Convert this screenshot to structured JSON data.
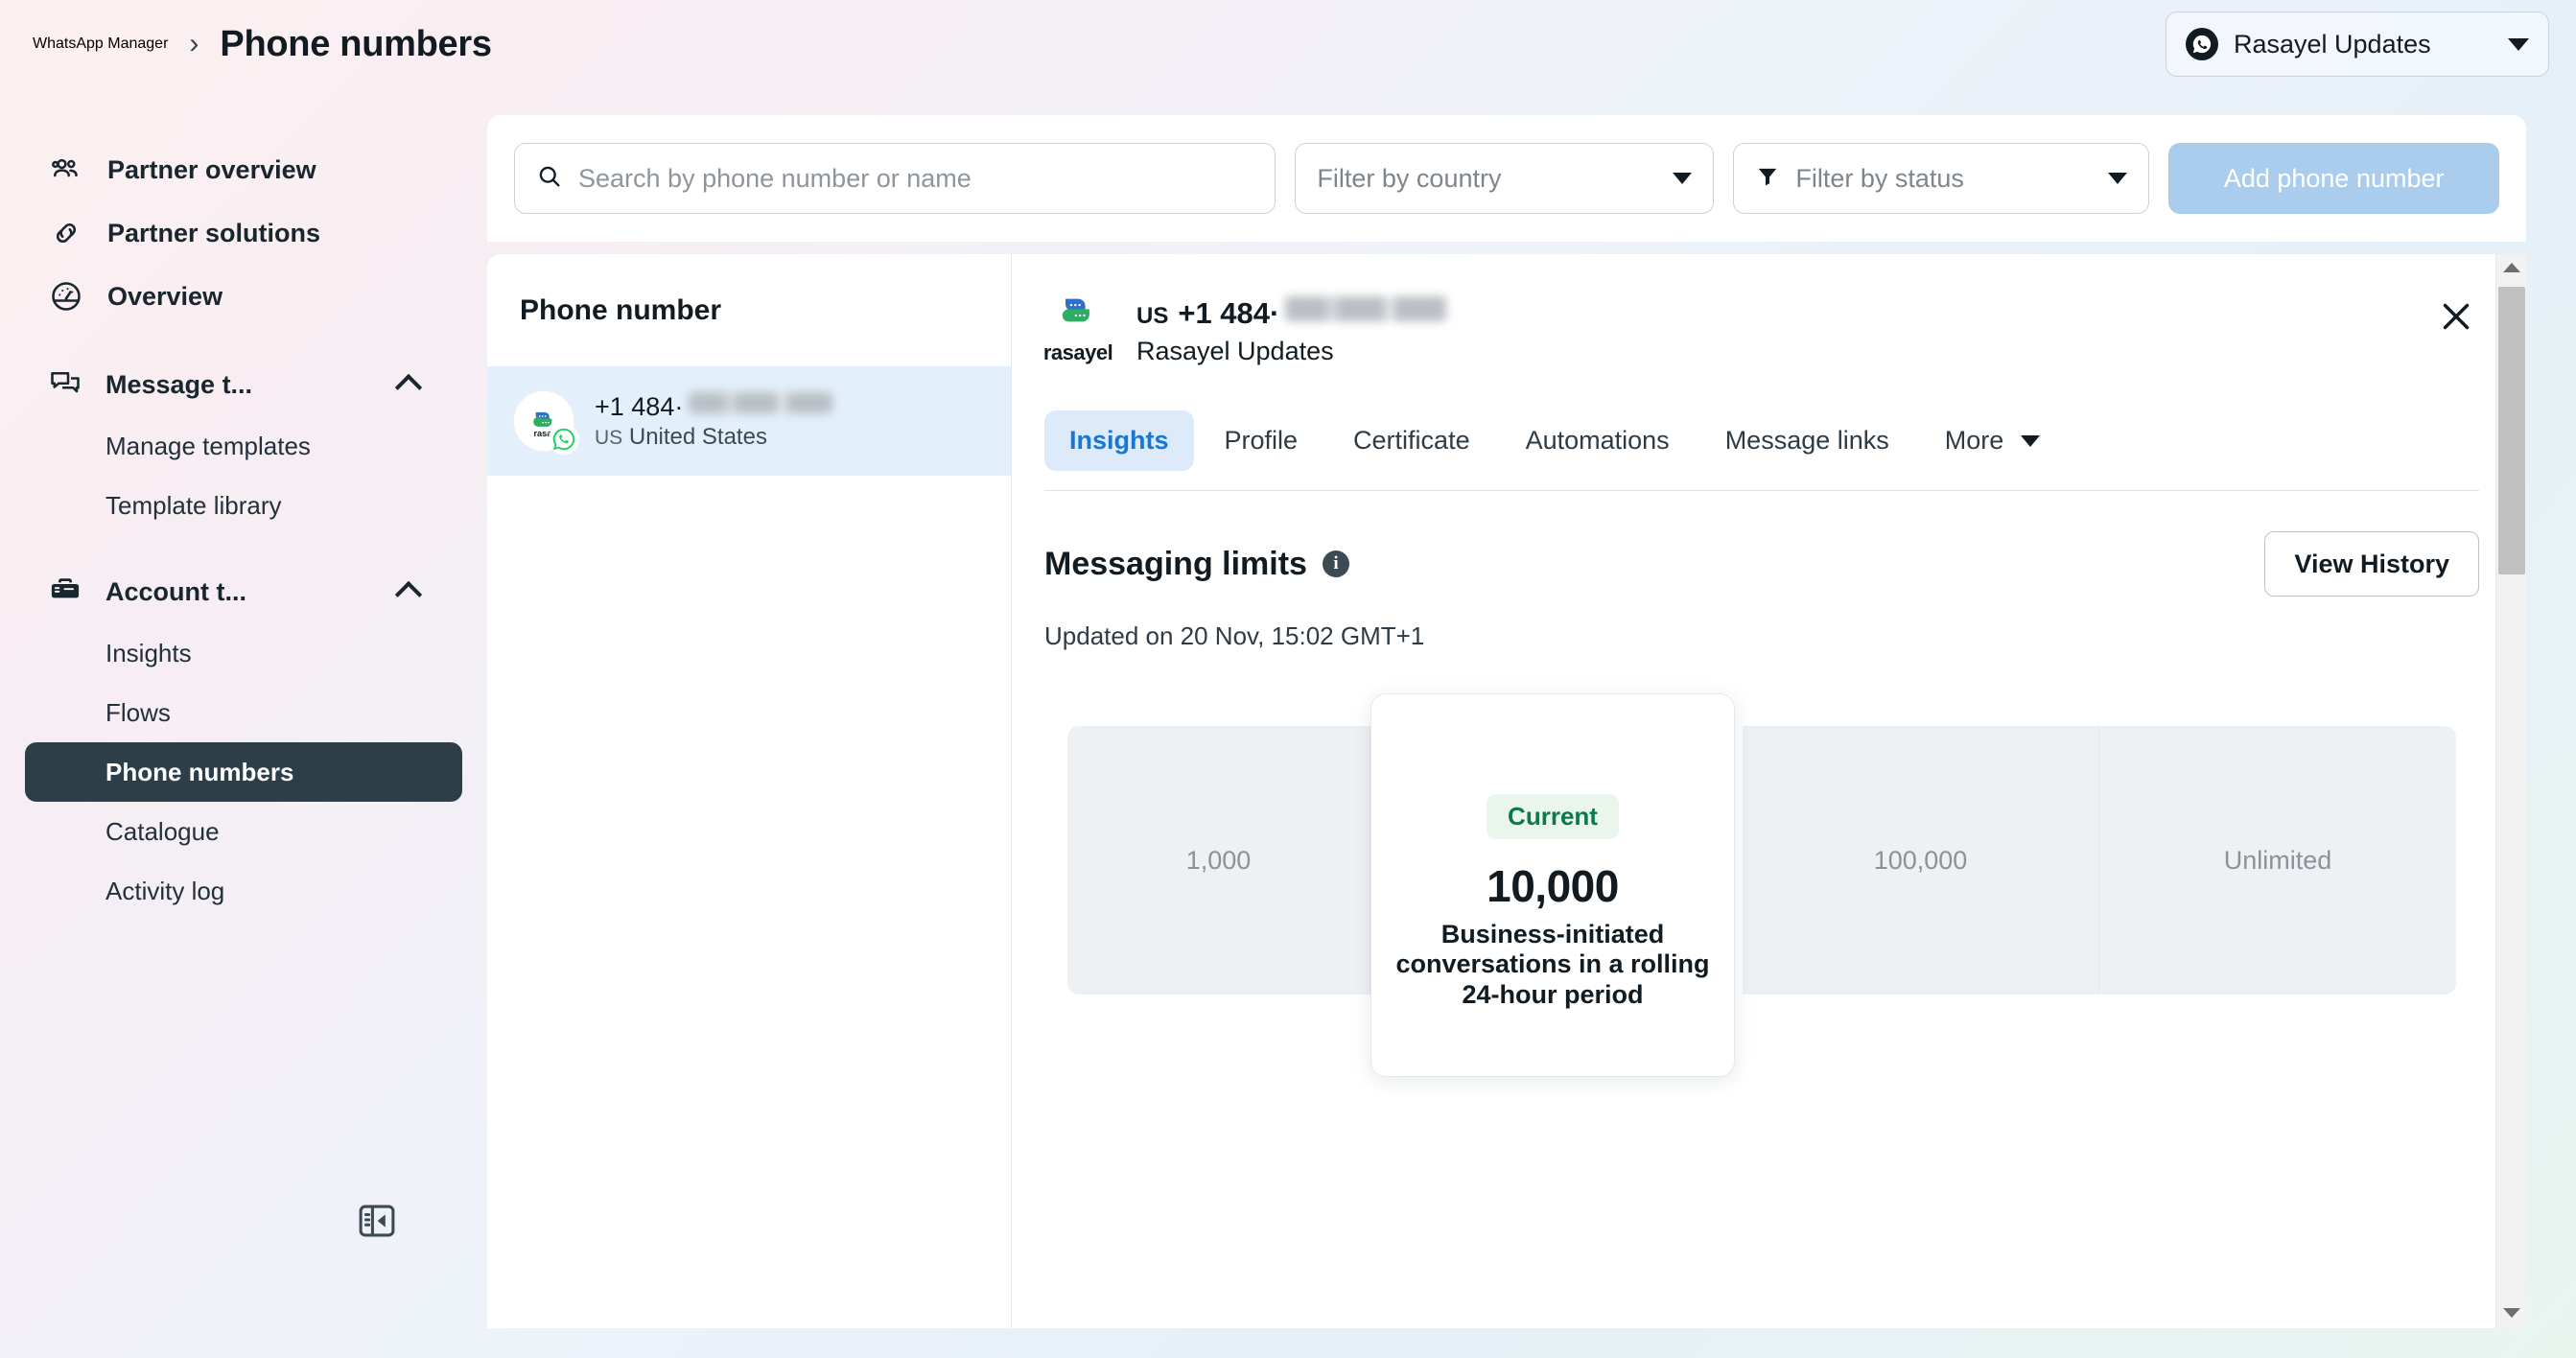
{
  "header": {
    "app_title": "WhatsApp Manager",
    "separator": "›",
    "page_title": "Phone numbers",
    "account_name": "Rasayel Updates"
  },
  "sidebar": {
    "items": [
      {
        "label": "Partner overview",
        "icon": "people-icon"
      },
      {
        "label": "Partner solutions",
        "icon": "link-icon"
      },
      {
        "label": "Overview",
        "icon": "gauge-icon"
      }
    ],
    "groups": [
      {
        "label": "Message t...",
        "icon": "chat-bubbles-icon",
        "items": [
          {
            "label": "Manage templates",
            "active": false
          },
          {
            "label": "Template library",
            "active": false
          }
        ]
      },
      {
        "label": "Account t...",
        "icon": "toolbox-icon",
        "items": [
          {
            "label": "Insights",
            "active": false
          },
          {
            "label": "Flows",
            "active": false
          },
          {
            "label": "Phone numbers",
            "active": true
          },
          {
            "label": "Catalogue",
            "active": false
          },
          {
            "label": "Activity log",
            "active": false
          }
        ]
      }
    ],
    "collapse_icon": "sidebar-collapse-icon"
  },
  "toolbar": {
    "search_placeholder": "Search by phone number or name",
    "search_value": "",
    "filter_country_label": "Filter by country",
    "filter_status_label": "Filter by status",
    "add_button_label": "Add phone number"
  },
  "list": {
    "column_header": "Phone number",
    "rows": [
      {
        "number_visible": "+1 484·",
        "number_masked": "███-████",
        "country_code": "US",
        "country": "United States",
        "brand": "rasa"
      }
    ]
  },
  "detail": {
    "brand": "rasayel",
    "country_code": "US",
    "number_visible": "+1 484·",
    "number_masked": "███-████",
    "display_name": "Rasayel Updates",
    "close_icon": "close-icon",
    "tabs": [
      {
        "label": "Insights",
        "active": true
      },
      {
        "label": "Profile",
        "active": false
      },
      {
        "label": "Certificate",
        "active": false
      },
      {
        "label": "Automations",
        "active": false
      },
      {
        "label": "Message links",
        "active": false
      },
      {
        "label": "More",
        "active": false,
        "has_caret": true
      }
    ],
    "section": {
      "title": "Messaging limits",
      "info_icon": "info-icon",
      "view_history_label": "View History",
      "updated_text": "Updated on 20 Nov, 15:02 GMT+1"
    },
    "messaging_limits": {
      "tiers": [
        {
          "label": "1,000",
          "current": false
        },
        {
          "label": "10,000",
          "current": true
        },
        {
          "label": "100,000",
          "current": false
        },
        {
          "label": "Unlimited",
          "current": false
        }
      ],
      "current_badge": "Current",
      "current_value": "10,000",
      "current_description": "Business-initiated conversations in a rolling 24-hour period"
    }
  },
  "colors": {
    "accent_blue": "#1877d2",
    "active_nav_bg": "#2e3e49",
    "current_green": "#0a7a47",
    "tier_bg": "#eef1f4",
    "add_button_bg": "#aacdee"
  }
}
